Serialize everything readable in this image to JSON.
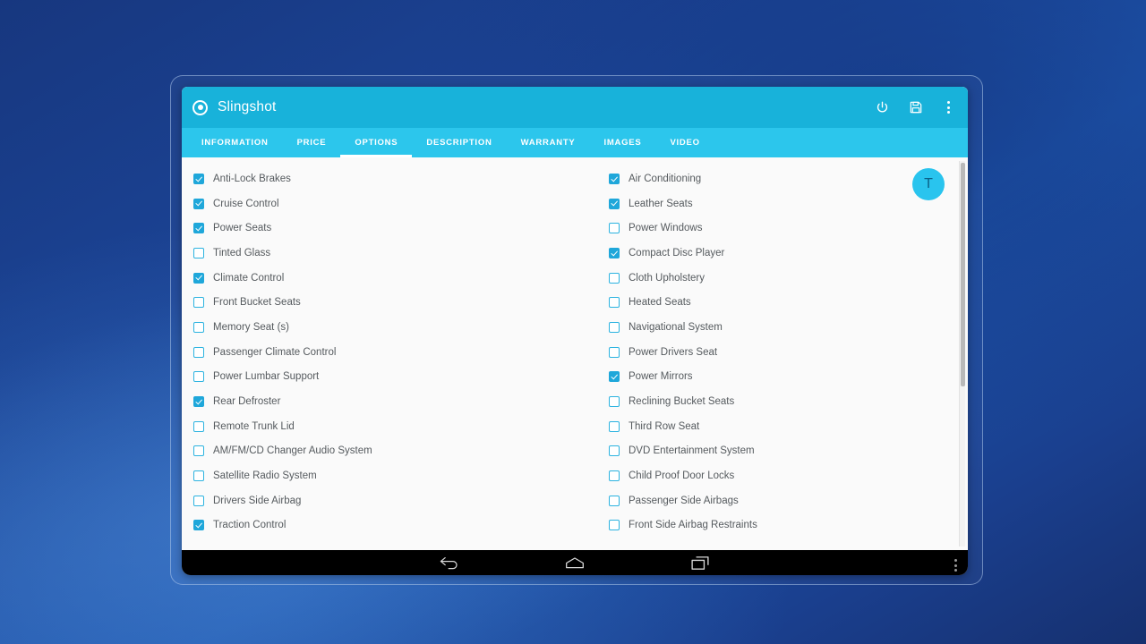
{
  "app": {
    "title": "Slingshot",
    "logo_icon": "target-dot-icon",
    "actions": [
      {
        "name": "power-button",
        "icon": "power-icon"
      },
      {
        "name": "save-button",
        "icon": "floppy-disk-save-icon"
      },
      {
        "name": "overflow-menu-button",
        "icon": "three-dots-vertical-icon"
      }
    ]
  },
  "tabs": [
    {
      "label": "INFORMATION",
      "active": false
    },
    {
      "label": "PRICE",
      "active": false
    },
    {
      "label": "OPTIONS",
      "active": true
    },
    {
      "label": "DESCRIPTION",
      "active": false
    },
    {
      "label": "WARRANTY",
      "active": false
    },
    {
      "label": "IMAGES",
      "active": false
    },
    {
      "label": "VIDEO",
      "active": false
    }
  ],
  "options": {
    "left_column": [
      {
        "label": "Anti-Lock Brakes",
        "checked": true
      },
      {
        "label": "Cruise Control",
        "checked": true
      },
      {
        "label": "Power Seats",
        "checked": true
      },
      {
        "label": "Tinted Glass",
        "checked": false
      },
      {
        "label": "Climate Control",
        "checked": true
      },
      {
        "label": "Front Bucket Seats",
        "checked": false
      },
      {
        "label": "Memory Seat (s)",
        "checked": false
      },
      {
        "label": "Passenger Climate Control",
        "checked": false
      },
      {
        "label": "Power Lumbar Support",
        "checked": false
      },
      {
        "label": "Rear Defroster",
        "checked": true
      },
      {
        "label": "Remote Trunk Lid",
        "checked": false
      },
      {
        "label": "AM/FM/CD Changer Audio System",
        "checked": false
      },
      {
        "label": "Satellite Radio System",
        "checked": false
      },
      {
        "label": "Drivers Side Airbag",
        "checked": false
      },
      {
        "label": "Traction Control",
        "checked": true
      }
    ],
    "right_column": [
      {
        "label": "Air Conditioning",
        "checked": true
      },
      {
        "label": "Leather Seats",
        "checked": true
      },
      {
        "label": "Power Windows",
        "checked": false
      },
      {
        "label": "Compact Disc Player",
        "checked": true
      },
      {
        "label": "Cloth Upholstery",
        "checked": false
      },
      {
        "label": "Heated Seats",
        "checked": false
      },
      {
        "label": "Navigational System",
        "checked": false
      },
      {
        "label": "Power Drivers Seat",
        "checked": false
      },
      {
        "label": "Power Mirrors",
        "checked": true
      },
      {
        "label": "Reclining Bucket Seats",
        "checked": false
      },
      {
        "label": "Third Row Seat",
        "checked": false
      },
      {
        "label": "DVD Entertainment System",
        "checked": false
      },
      {
        "label": "Child Proof Door Locks",
        "checked": false
      },
      {
        "label": "Passenger Side Airbags",
        "checked": false
      },
      {
        "label": "Front Side Airbag Restraints",
        "checked": false
      }
    ]
  },
  "avatar": {
    "initial": "T"
  },
  "navbar": {
    "buttons": [
      {
        "name": "android-back-button",
        "icon": "back-arrow-icon"
      },
      {
        "name": "android-home-button",
        "icon": "home-icon"
      },
      {
        "name": "android-recents-button",
        "icon": "recent-apps-icon"
      }
    ],
    "overflow": {
      "name": "android-overflow-menu",
      "icon": "three-dots-vertical-icon"
    }
  },
  "colors": {
    "appbar": "#18b2da",
    "tabbar": "#2cc6ec",
    "accent": "#1fa7da",
    "avatar": "#29c4ee",
    "content_bg": "#fafafa",
    "label_text": "#555a5e"
  }
}
